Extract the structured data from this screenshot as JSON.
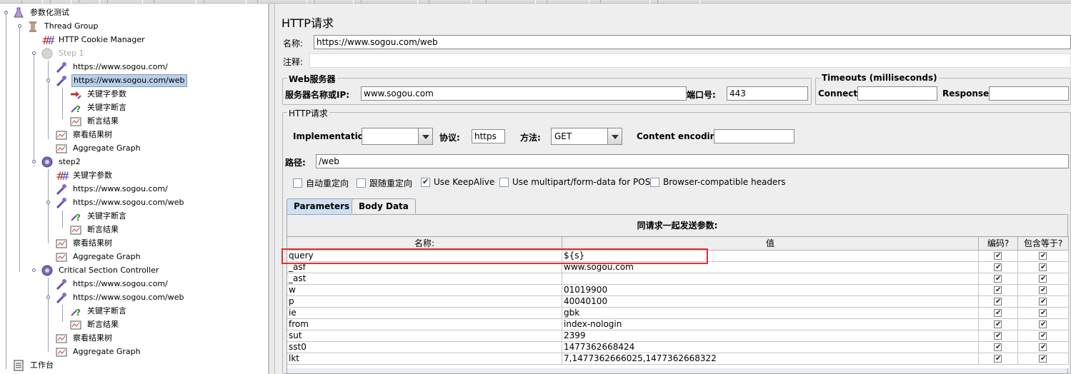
{
  "tree": {
    "root": "参数化测试",
    "thread_group": "Thread Group",
    "cookie_manager": "HTTP Cookie Manager",
    "step1": "Step 1",
    "step1_req1": "https://www.sogou.com/",
    "step1_req2": "https://www.sogou.com/web",
    "step1_kw_param": "关键字参数",
    "step1_kw_assert": "关键字断言",
    "step1_assert_result": "断言结果",
    "step1_view_tree": "察看结果树",
    "step1_agg": "Aggregate Graph",
    "step2": "step2",
    "step2_kw_param": "关键字参数",
    "step2_req1": "https://www.sogou.com/",
    "step2_req2": "https://www.sogou.com/web",
    "step2_kw_assert": "关键字断言",
    "step2_assert_result": "断言结果",
    "step2_view_tree": "察看结果树",
    "step2_agg": "Aggregate Graph",
    "csc": "Critical Section Controller",
    "csc_req1": "https://www.sogou.com/",
    "csc_req2": "https://www.sogou.com/web",
    "csc_kw_assert": "关键字断言",
    "csc_assert_result": "断言结果",
    "csc_view_tree": "察看结果树",
    "csc_agg": "Aggregate Graph",
    "workbench": "工作台"
  },
  "sampler": {
    "title": "HTTP请求",
    "name_label": "名称:",
    "name_value": "https://www.sogou.com/web",
    "comment_label": "注释:",
    "comment_value": "",
    "web_server": {
      "title": "Web服务器",
      "server_label": "服务器名称或IP:",
      "server_value": "www.sogou.com",
      "port_label": "端口号:",
      "port_value": "443"
    },
    "timeouts": {
      "title": "Timeouts (milliseconds)",
      "connect_label": "Connect:",
      "connect_value": "",
      "response_label": "Response:",
      "response_value": ""
    },
    "http_request": {
      "title": "HTTP请求",
      "impl_label": "Implementation:",
      "impl_value": "",
      "protocol_label": "协议:",
      "protocol_value": "https",
      "method_label": "方法:",
      "method_value": "GET",
      "encoding_label": "Content encoding:",
      "encoding_value": "",
      "path_label": "路径:",
      "path_value": "/web"
    },
    "options": {
      "auto_redirect": "自动重定向",
      "follow_redirect": "跟随重定向",
      "keepalive": "Use KeepAlive",
      "multipart": "Use multipart/form-data for POST",
      "browser_headers": "Browser-compatible headers"
    },
    "options_state": {
      "auto_redirect": false,
      "follow_redirect": false,
      "keepalive": true,
      "multipart": false,
      "browser_headers": false
    },
    "tabs": {
      "parameters": "Parameters",
      "body": "Body Data"
    },
    "params": {
      "caption": "同请求一起发送参数:",
      "col_name": "名称:",
      "col_value": "值",
      "col_encode": "编码?",
      "col_include_equals": "包含等于?",
      "rows": [
        {
          "name": "query",
          "value": "${s}",
          "encode": true,
          "eq": true
        },
        {
          "name": "_asf",
          "value": "www.sogou.com",
          "encode": true,
          "eq": true
        },
        {
          "name": "_ast",
          "value": "",
          "encode": true,
          "eq": true
        },
        {
          "name": "w",
          "value": "01019900",
          "encode": true,
          "eq": true
        },
        {
          "name": "p",
          "value": "40040100",
          "encode": true,
          "eq": true
        },
        {
          "name": "ie",
          "value": "gbk",
          "encode": true,
          "eq": true
        },
        {
          "name": "from",
          "value": "index-nologin",
          "encode": true,
          "eq": true
        },
        {
          "name": "sut",
          "value": "2399",
          "encode": true,
          "eq": true
        },
        {
          "name": "sst0",
          "value": "1477362668424",
          "encode": true,
          "eq": true
        },
        {
          "name": "lkt",
          "value": "7,1477362666025,1477362668322",
          "encode": true,
          "eq": true
        }
      ]
    }
  },
  "colors": {
    "selection": "#b8cfe5",
    "highlight": "#e03333",
    "tab_active": "#cfe0f4"
  }
}
